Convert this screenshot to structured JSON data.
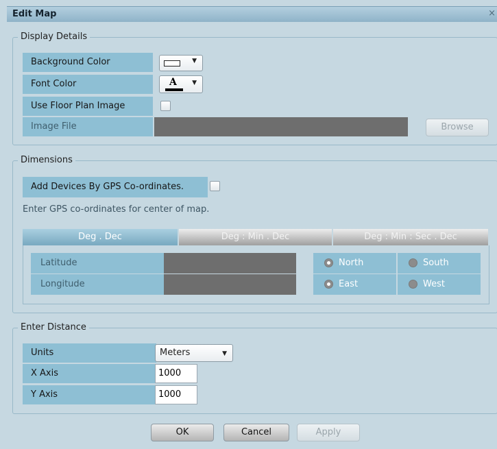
{
  "window": {
    "title": "Edit Map",
    "close_glyph": "×"
  },
  "display_details": {
    "legend": "Display Details",
    "background_color_label": "Background Color",
    "font_color_label": "Font Color",
    "font_color_glyph": "A",
    "use_floor_plan_label": "Use Floor Plan Image",
    "image_file_label": "Image File",
    "browse_label": "Browse",
    "background_color_value": "#ffffff",
    "font_color_value": "#000000"
  },
  "dimensions": {
    "legend": "Dimensions",
    "add_devices_label": "Add Devices By GPS Co-ordinates.",
    "instruction": "Enter GPS co-ordinates for center of map.",
    "tabs": [
      "Deg . Dec",
      "Deg : Min . Dec",
      "Deg : Min : Sec . Dec"
    ],
    "latitude_label": "Latitude",
    "longitude_label": "Longitude",
    "north_label": "North",
    "south_label": "South",
    "east_label": "East",
    "west_label": "West"
  },
  "distance": {
    "legend": "Enter Distance",
    "units_label": "Units",
    "units_value": "Meters",
    "x_axis_label": "X Axis",
    "x_axis_value": "1000",
    "y_axis_label": "Y Axis",
    "y_axis_value": "1000"
  },
  "buttons": {
    "ok": "OK",
    "cancel": "Cancel",
    "apply": "Apply"
  },
  "icons": {
    "dropdown": "▼"
  }
}
